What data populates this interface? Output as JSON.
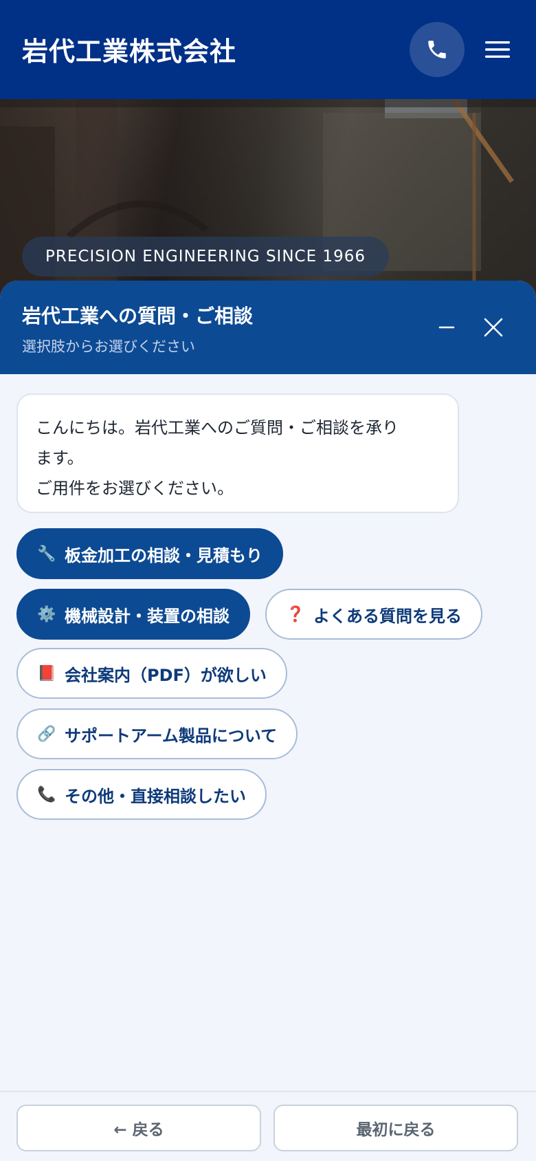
{
  "header": {
    "brand": "岩代工業株式会社",
    "phone_icon": "phone-icon",
    "menu_icon": "hamburger-menu-icon"
  },
  "hero": {
    "tagline": "PRECISION ENGINEERING SINCE 1966"
  },
  "chat": {
    "title": "岩代工業への質問・ご相談",
    "subtitle": "選択肢からお選びください",
    "minimize_icon": "minimize-icon",
    "close_icon": "close-icon",
    "greeting": {
      "line1": "こんにちは。岩代工業へのご質問・ご相談を承り",
      "line2": "ます。",
      "line3": "ご用件をお選びください。"
    },
    "options": [
      {
        "icon": "🔧",
        "label": "板金加工の相談・見積もり",
        "style": "filled"
      },
      {
        "icon": "⚙️",
        "label": "機械設計・装置の相談",
        "style": "filled"
      },
      {
        "icon": "❓",
        "label": "よくある質問を見る",
        "style": "outline"
      },
      {
        "icon": "📕",
        "label": "会社案内（PDF）が欲しい",
        "style": "outline"
      },
      {
        "icon": "🔗",
        "label": "サポートアーム製品について",
        "style": "outline"
      },
      {
        "icon": "📞",
        "label": "その他・直接相談したい",
        "style": "outline"
      }
    ]
  },
  "footer": {
    "back_label": "← 戻る",
    "restart_label": "最初に戻る"
  },
  "colors": {
    "header_bg": "#013087",
    "chat_header_bg": "#0d4a94",
    "option_filled_bg": "#0d4a94",
    "option_outline_text": "#0e3a7a",
    "page_bg": "#f2f5fb"
  }
}
